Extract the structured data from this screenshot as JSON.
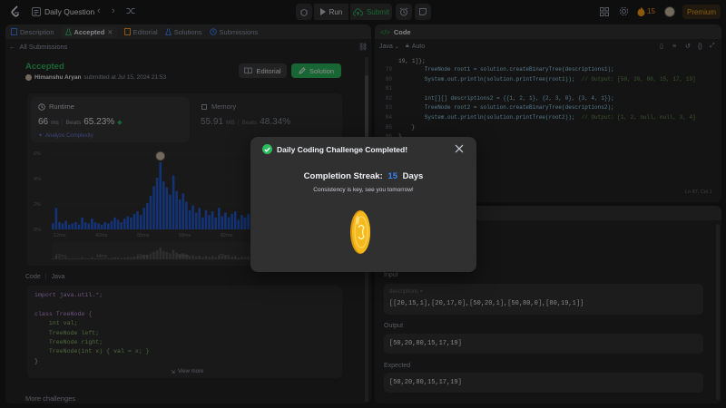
{
  "topbar": {
    "title": "Daily Question",
    "run_label": "Run",
    "submit_label": "Submit",
    "streak_count": "15",
    "premium_label": "Premium"
  },
  "left_tabs": {
    "description": "Description",
    "accepted": "Accepted",
    "editorial": "Editorial",
    "solutions": "Solutions",
    "submissions": "Submissions"
  },
  "submission": {
    "back_label": "All Submissions",
    "status": "Accepted",
    "user": "Himanshu Aryan",
    "submitted_text": "submitted at Jul 15, 2024 21:53",
    "editorial_button": "Editorial",
    "solution_button": "Solution"
  },
  "runtime": {
    "label": "Runtime",
    "value": "66",
    "unit": "ms",
    "beats_label": "Beats",
    "beats_value": "65.23%",
    "analyze_label": "Analyze Complexity"
  },
  "memory": {
    "label": "Memory",
    "value": "55.91",
    "unit": "MB",
    "beats_label": "Beats",
    "beats_value": "48.34%"
  },
  "chart_data": {
    "type": "bar",
    "yticks": [
      "6%",
      "4%",
      "2%",
      "0%"
    ],
    "xticks": [
      "12ms",
      "42ms",
      "55ms",
      "69ms",
      "82ms",
      "96ms"
    ],
    "mini_xticks": [
      "12ms",
      "44ms",
      "59ms",
      "69ms",
      "79ms"
    ],
    "values": [
      0.5,
      1.8,
      0.6,
      0.5,
      0.7,
      0.4,
      0.5,
      0.6,
      0.4,
      1.0,
      0.6,
      0.5,
      0.9,
      0.6,
      0.5,
      0.4,
      0.6,
      0.5,
      0.7,
      1.0,
      0.8,
      0.6,
      0.9,
      1.1,
      1.0,
      1.3,
      1.5,
      1.2,
      1.8,
      2.2,
      2.8,
      3.6,
      4.3,
      5.6,
      4.0,
      3.5,
      2.9,
      4.5,
      3.2,
      2.5,
      3.0,
      2.3,
      1.6,
      2.0,
      1.4,
      1.8,
      1.0,
      1.6,
      1.2,
      1.5,
      1.0,
      1.8,
      1.1,
      1.4,
      1.0,
      1.3,
      1.5,
      0.8,
      1.2,
      1.0,
      1.3,
      0.9,
      1.1,
      0.7,
      1.0,
      1.6,
      1.1,
      0.8
    ],
    "ylim": [
      0,
      7
    ],
    "highlight_index": 33
  },
  "code_section": {
    "label": "Code",
    "lang": "Java",
    "lines": [
      "import java.util.*;",
      "",
      "class TreeNode {",
      "    int val;",
      "    TreeNode left;",
      "    TreeNode right;",
      "    TreeNode(int x) { val = x; }",
      "}"
    ],
    "view_more": "View more",
    "more_challenges": "More challenges"
  },
  "editor": {
    "title": "Code",
    "lang": "Java",
    "auto": "Auto",
    "first_line": "19, 1]};",
    "line_numbers": [
      "79",
      "80",
      "81",
      "82",
      "83",
      "84",
      "85",
      "86"
    ],
    "lines": [
      "        TreeNode root1 = solution.createBinaryTree(descriptions1);",
      "        System.out.println(solution.printTree(root1));  // Output: [50, 20, 80, 15, 17, 19]",
      "",
      "        int[][] descriptions2 = {{1, 2, 1}, {2, 3, 0}, {3, 4, 1}};",
      "        TreeNode root2 = solution.createBinaryTree(descriptions2);",
      "        System.out.println(solution.printTree(root2));  // Output: [1, 2, null, null, 3, 4]",
      "    }",
      "}"
    ],
    "status": "Ln 87, Col 1"
  },
  "testcase": {
    "input_label": "Input",
    "descriptions_label": "descriptions =",
    "descriptions_value": "[[20,15,1],[20,17,0],[50,20,1],[50,80,0],[80,19,1]]",
    "output_label": "Output",
    "output_value": "[50,20,80,15,17,19]",
    "expected_label": "Expected",
    "expected_value": "[50,20,80,15,17,19]"
  },
  "modal": {
    "title": "Daily Coding Challenge Completed!",
    "streak_label": "Completion Streak:",
    "streak_value": "15",
    "streak_unit": "Days",
    "message": "Consistency is key, see you tomorrow!"
  },
  "colors": {
    "green": "#2cbb5d",
    "bar_blue": "#2563eb",
    "orange": "#ffa116",
    "gold": "#f5b91e"
  }
}
